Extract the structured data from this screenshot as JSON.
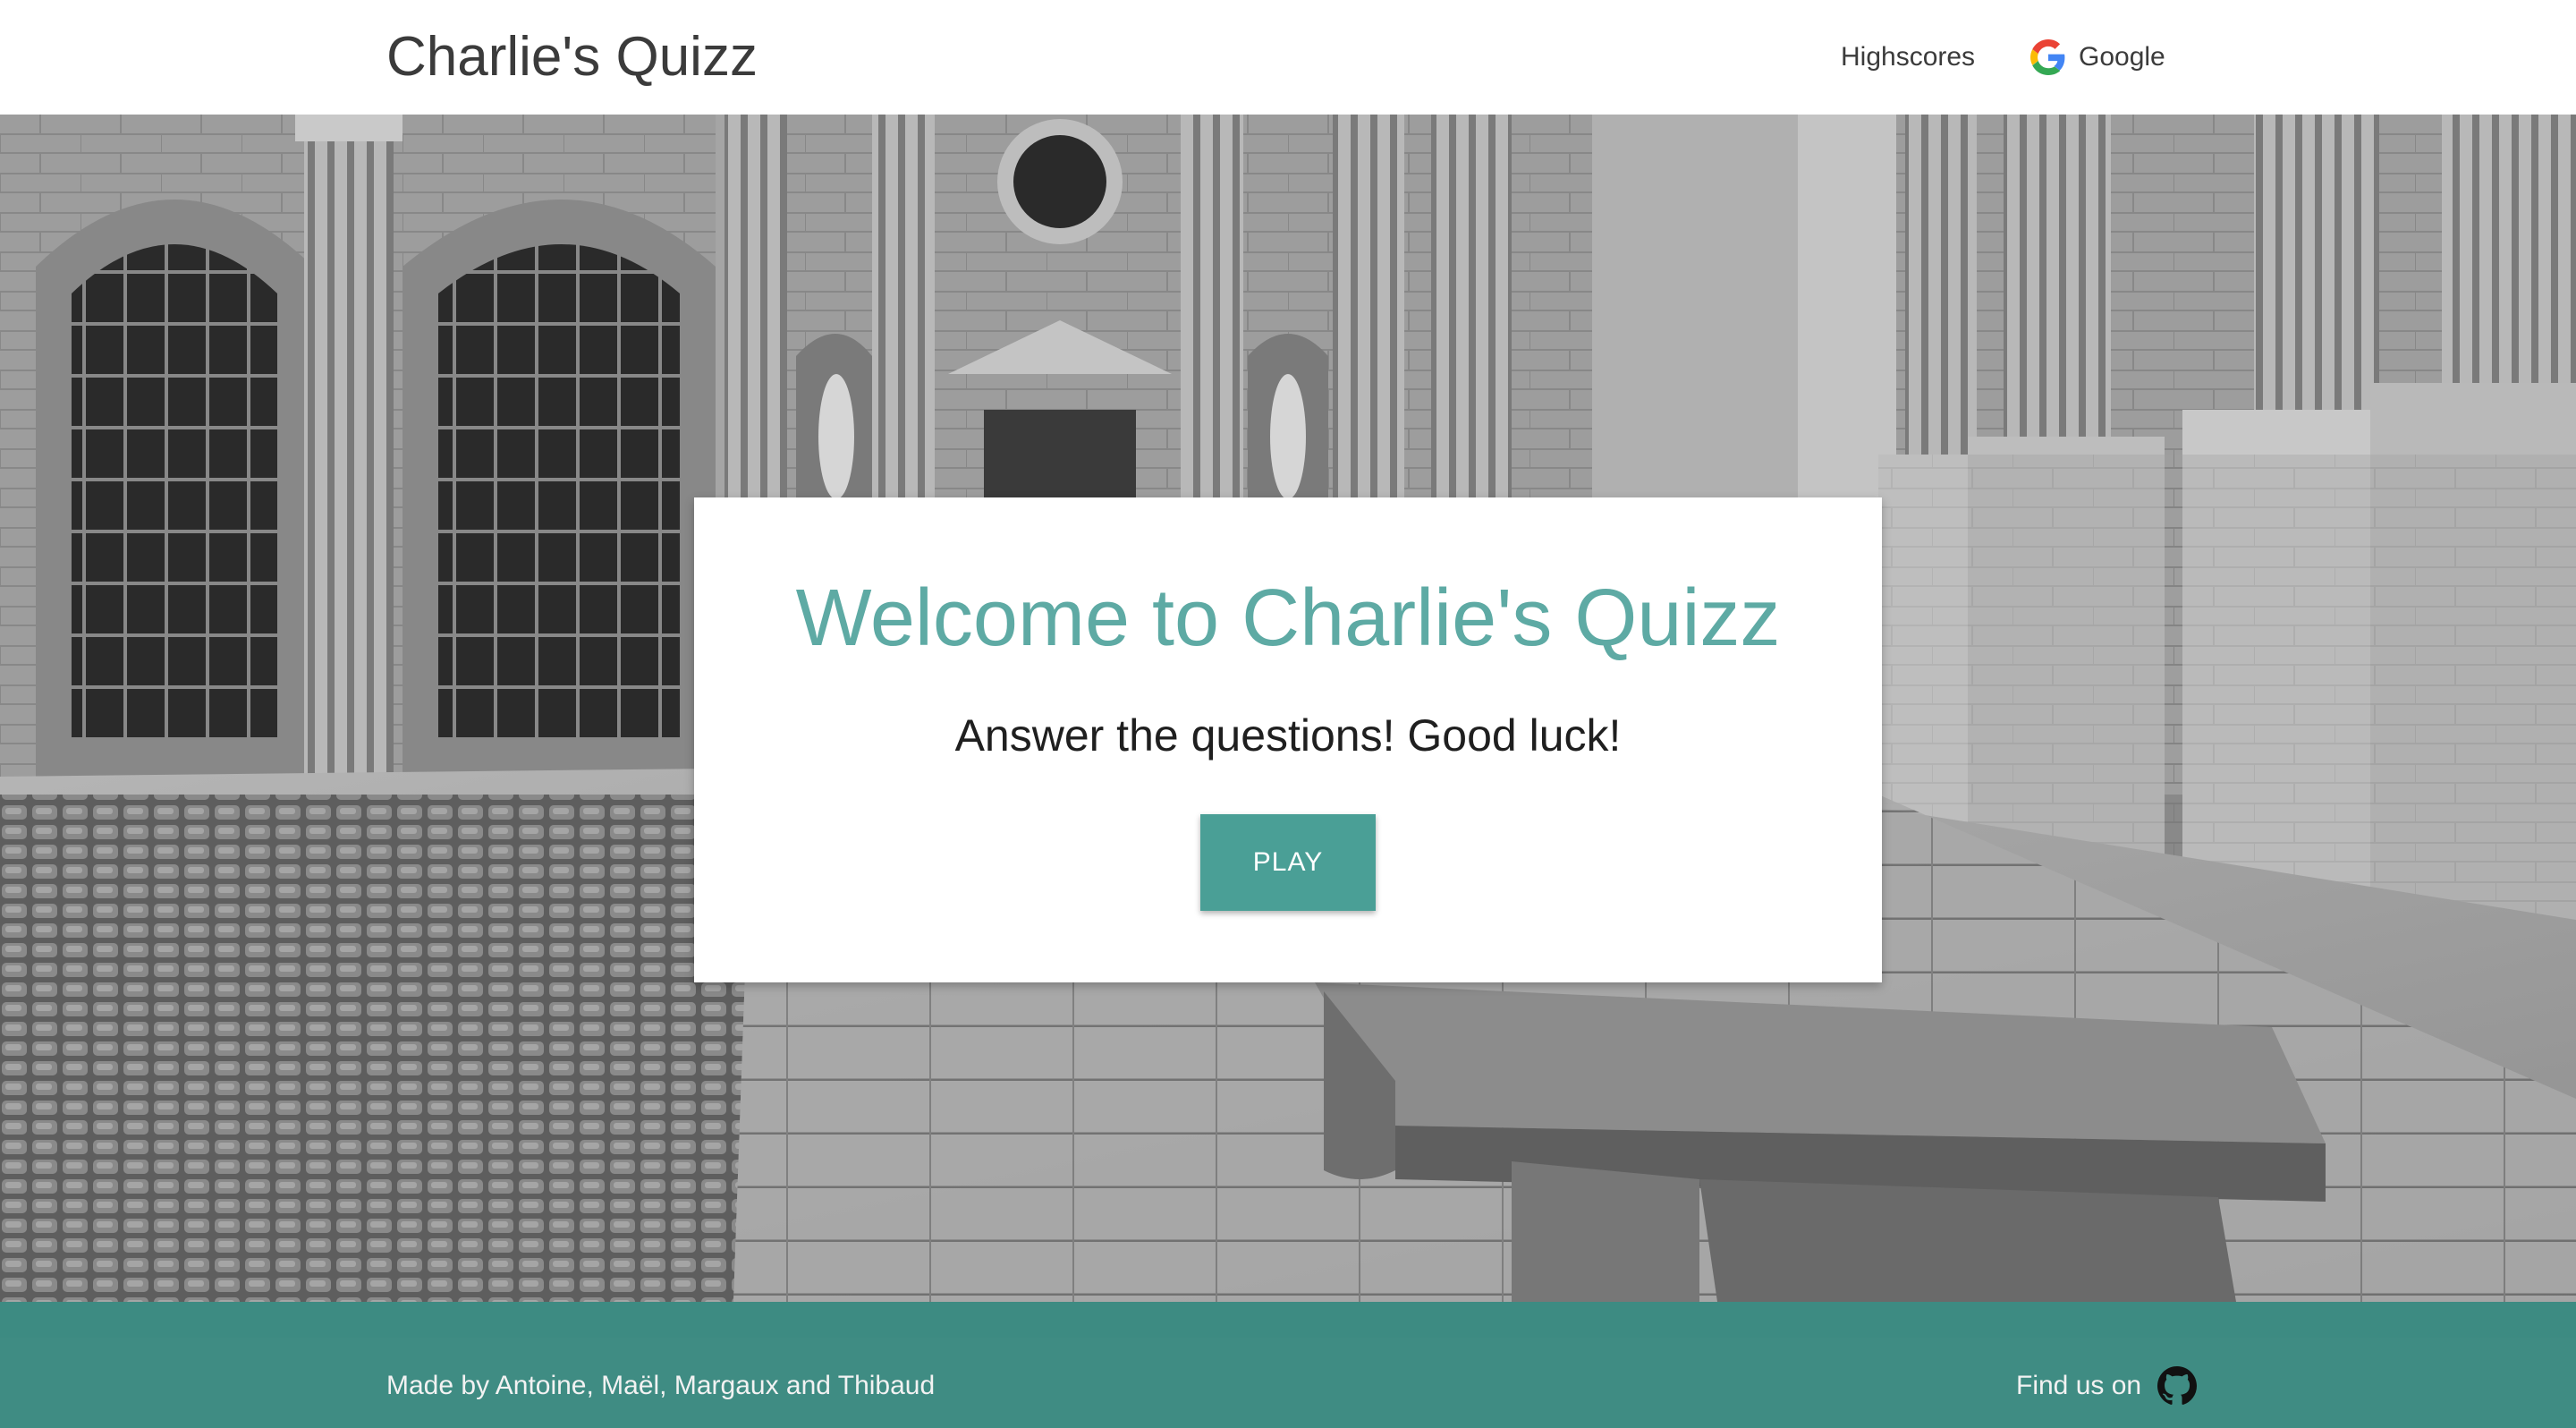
{
  "navbar": {
    "brand": "Charlie's Quizz",
    "links": {
      "highscores": "Highscores",
      "google": "Google"
    },
    "google_icon": "google-g-icon"
  },
  "hero": {
    "background": "black-and-white-photo-of-classical-courtyard-with-stone-bench",
    "card": {
      "title": "Welcome to Charlie's Quizz",
      "subtitle": "Answer the questions! Good luck!",
      "play_label": "PLAY"
    }
  },
  "footer": {
    "credits": "Made by Antoine, Maël, Margaux and Thibaud",
    "find_us": "Find us on",
    "github_icon": "github-icon"
  },
  "colors": {
    "accent": "#5eaaa4",
    "button": "#4a9f96",
    "footer": "#3f8c83",
    "navbar_text": "#3b3b3b"
  }
}
